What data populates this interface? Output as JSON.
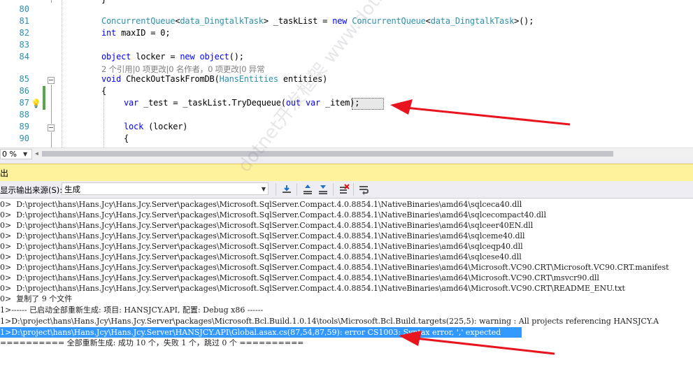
{
  "editor": {
    "lines": [
      {
        "num": "80",
        "text": ""
      },
      {
        "num": "81",
        "text": "ConcurrentQueue<data_DingtalkTask> _taskList = new ConcurrentQueue<data_DingtalkTask>();"
      },
      {
        "num": "82",
        "text": "int maxID = 0;"
      },
      {
        "num": "83",
        "text": ""
      },
      {
        "num": "84",
        "text": "object locker = new object();"
      },
      {
        "num": "",
        "text": "2 个引用|0 项更改|0 名作者，0 项更改|0 异常"
      },
      {
        "num": "85",
        "text": "void CheckOutTaskFromDB(HansEntities entities)"
      },
      {
        "num": "86",
        "text": "{"
      },
      {
        "num": "87",
        "text": "var _test = _taskList.TryDequeue(out var _item);"
      },
      {
        "num": "88",
        "text": ""
      },
      {
        "num": "89",
        "text": "lock (locker)"
      },
      {
        "num": "90",
        "text": "{"
      }
    ],
    "codelens": "2 个引用|0 项更改|0 名作者，0 项更改|0 异常",
    "zoom": "0 %"
  },
  "output": {
    "title": "出",
    "source_label": "显示输出来源(S):",
    "source_value": "生成",
    "lines": [
      "0>  D:\\project\\hans\\Hans.Jcy\\Hans.Jcy.Server\\packages\\Microsoft.SqlServer.Compact.4.0.8854.1\\NativeBinaries\\amd64\\sqlceca40.dll",
      "0>  D:\\project\\hans\\Hans.Jcy\\Hans.Jcy.Server\\packages\\Microsoft.SqlServer.Compact.4.0.8854.1\\NativeBinaries\\amd64\\sqlcecompact40.dll",
      "0>  D:\\project\\hans\\Hans.Jcy\\Hans.Jcy.Server\\packages\\Microsoft.SqlServer.Compact.4.0.8854.1\\NativeBinaries\\amd64\\sqlceer40EN.dll",
      "0>  D:\\project\\hans\\Hans.Jcy\\Hans.Jcy.Server\\packages\\Microsoft.SqlServer.Compact.4.0.8854.1\\NativeBinaries\\amd64\\sqlceme40.dll",
      "0>  D:\\project\\hans\\Hans.Jcy\\Hans.Jcy.Server\\packages\\Microsoft.SqlServer.Compact.4.0.8854.1\\NativeBinaries\\amd64\\sqlceqp40.dll",
      "0>  D:\\project\\hans\\Hans.Jcy\\Hans.Jcy.Server\\packages\\Microsoft.SqlServer.Compact.4.0.8854.1\\NativeBinaries\\amd64\\sqlcese40.dll",
      "0>  D:\\project\\hans\\Hans.Jcy\\Hans.Jcy.Server\\packages\\Microsoft.SqlServer.Compact.4.0.8854.1\\NativeBinaries\\amd64\\Microsoft.VC90.CRT\\Microsoft.VC90.CRT.manifest",
      "0>  D:\\project\\hans\\Hans.Jcy\\Hans.Jcy.Server\\packages\\Microsoft.SqlServer.Compact.4.0.8854.1\\NativeBinaries\\amd64\\Microsoft.VC90.CRT\\msvcr90.dll",
      "0>  D:\\project\\hans\\Hans.Jcy\\Hans.Jcy.Server\\packages\\Microsoft.SqlServer.Compact.4.0.8854.1\\NativeBinaries\\amd64\\Microsoft.VC90.CRT\\README_ENU.txt",
      "0>  复制了 9 个文件",
      "1>------ 已启动全部重新生成: 项目: HANSJCY.API, 配置: Debug x86 ------",
      "1>D:\\project\\hans\\Hans.Jcy\\Hans.Jcy.Server\\packages\\Microsoft.Bcl.Build.1.0.14\\tools\\Microsoft.Bcl.Build.targets(225,5): warning : All projects referencing HANSJCY.A",
      "1>D:\\project\\hans\\Hans.Jcy\\Hans.Jcy.Server\\HANSJCY.API\\Global.asax.cs(87,54,87,59): error CS1003: Syntax error, ',' expected",
      "========== 全部重新生成: 成功 10 个，失败 1 个，跳过 0 个 =========="
    ]
  },
  "watermark": "dotnet开发框架 www.dotnet.com",
  "colors": {
    "keyword": "#0000ff",
    "type": "#2b91af",
    "selection": "#3399ff",
    "output_header": "#fff29d",
    "arrow": "#e8141e"
  }
}
